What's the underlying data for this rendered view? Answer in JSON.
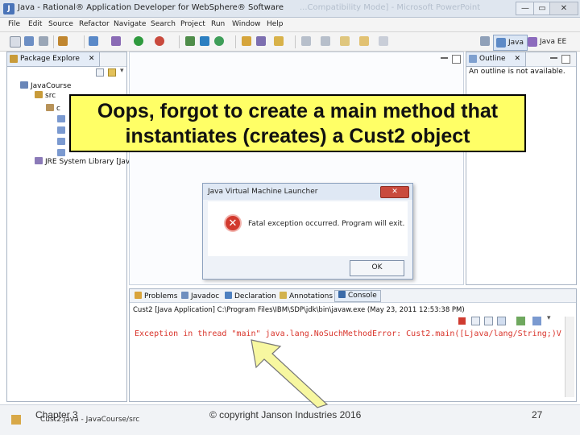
{
  "window": {
    "title": "Java - Rational® Application Developer for WebSphere® Software",
    "background_window_title": "...Compatibility Mode] - Microsoft PowerPoint",
    "minimize": "—",
    "maximize": "▭",
    "close": "✕"
  },
  "menu": [
    "File",
    "Edit",
    "Source",
    "Refactor",
    "Navigate",
    "Search",
    "Project",
    "Run",
    "Window",
    "Help"
  ],
  "perspectives": {
    "java": "Java",
    "java_ee": "Java EE"
  },
  "package_explorer": {
    "tab": "Package Explore",
    "close": "✕",
    "items": [
      {
        "label": "JavaCourse"
      },
      {
        "label": "src"
      },
      {
        "label": "c"
      },
      {
        "label": ""
      },
      {
        "label": ""
      },
      {
        "label": ""
      },
      {
        "label": ""
      },
      {
        "label": "JRE System Library [JavaSE"
      }
    ]
  },
  "outline": {
    "tab": "Outline",
    "close": "✕",
    "message": "An outline is not available."
  },
  "callout": {
    "line1": "Oops, forgot to create a main method that",
    "line2": "instantiates (creates) a Cust2 object"
  },
  "dialog": {
    "title": "Java Virtual Machine Launcher",
    "close": "✕",
    "message": "Fatal exception occurred. Program will exit.",
    "ok": "OK"
  },
  "console": {
    "tabs": [
      "Problems",
      "Javadoc",
      "Declaration",
      "Annotations",
      "Console"
    ],
    "launch_info": "Cust2 [Java Application] C:\\Program Files\\IBM\\SDP\\jdk\\bin\\javaw.exe (May 23, 2011 12:53:38 PM)",
    "error_line": "Exception in thread \"main\" java.lang.NoSuchMethodError: Cust2.main([Ljava/lang/String;)V"
  },
  "status_bar": {
    "selection": "Cust2.java - JavaCourse/src"
  },
  "footer": {
    "chapter": "Chapter 3",
    "copyright": "© copyright Janson Industries 2016",
    "page": "27"
  },
  "colors": {
    "callout_fill": "#ffff66",
    "arrow_fill": "#f7f7a0",
    "error_text": "#d9342b",
    "view_tab": "#e4ecf7"
  }
}
